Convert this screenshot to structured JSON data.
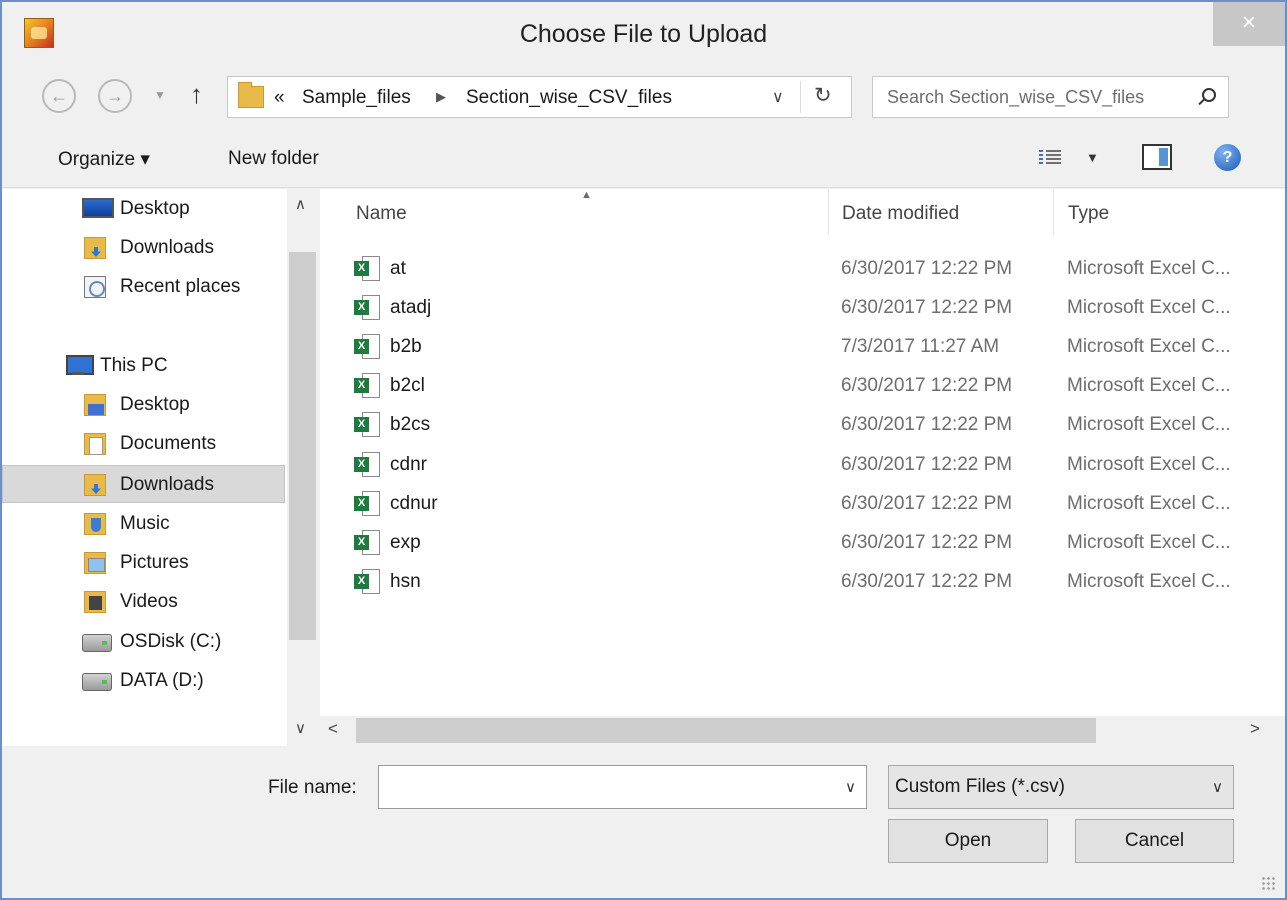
{
  "window": {
    "title": "Choose File to Upload",
    "close_label": "×",
    "app_icon": "app-logo-icon"
  },
  "navigation": {
    "back_icon": "back-arrow-icon",
    "forward_icon": "forward-arrow-icon",
    "up_icon": "up-arrow-icon",
    "breadcrumb_prefix": "«",
    "breadcrumbs": [
      "Sample_files",
      "Section_wise_CSV_files"
    ],
    "search_placeholder": "Search Section_wise_CSV_files"
  },
  "toolbar": {
    "organize_label": "Organize ▾",
    "new_folder_label": "New folder"
  },
  "sidebar": {
    "items": [
      {
        "label": "Desktop",
        "icon": "desktop-icon"
      },
      {
        "label": "Downloads",
        "icon": "downloads-folder-icon"
      },
      {
        "label": "Recent places",
        "icon": "recent-places-icon"
      },
      {
        "label": "This PC",
        "icon": "this-pc-icon"
      },
      {
        "label": "Desktop",
        "icon": "desktop-folder-icon"
      },
      {
        "label": "Documents",
        "icon": "documents-folder-icon"
      },
      {
        "label": "Downloads",
        "icon": "downloads-folder-icon",
        "selected": true
      },
      {
        "label": "Music",
        "icon": "music-folder-icon"
      },
      {
        "label": "Pictures",
        "icon": "pictures-folder-icon"
      },
      {
        "label": "Videos",
        "icon": "videos-folder-icon"
      },
      {
        "label": "OSDisk (C:)",
        "icon": "drive-icon"
      },
      {
        "label": "DATA (D:)",
        "icon": "drive-icon"
      }
    ]
  },
  "files": {
    "columns": [
      "Name",
      "Date modified",
      "Type"
    ],
    "sort_column": "Name",
    "rows": [
      {
        "name": "at",
        "date": "6/30/2017 12:22 PM",
        "type": "Microsoft Excel C..."
      },
      {
        "name": "atadj",
        "date": "6/30/2017 12:22 PM",
        "type": "Microsoft Excel C..."
      },
      {
        "name": "b2b",
        "date": "7/3/2017 11:27 AM",
        "type": "Microsoft Excel C..."
      },
      {
        "name": "b2cl",
        "date": "6/30/2017 12:22 PM",
        "type": "Microsoft Excel C..."
      },
      {
        "name": "b2cs",
        "date": "6/30/2017 12:22 PM",
        "type": "Microsoft Excel C..."
      },
      {
        "name": "cdnr",
        "date": "6/30/2017 12:22 PM",
        "type": "Microsoft Excel C..."
      },
      {
        "name": "cdnur",
        "date": "6/30/2017 12:22 PM",
        "type": "Microsoft Excel C..."
      },
      {
        "name": "exp",
        "date": "6/30/2017 12:22 PM",
        "type": "Microsoft Excel C..."
      },
      {
        "name": "hsn",
        "date": "6/30/2017 12:22 PM",
        "type": "Microsoft Excel C..."
      }
    ]
  },
  "footer": {
    "file_name_label": "File name:",
    "file_name_value": "",
    "filter_value": "Custom Files (*.csv)",
    "open_label": "Open",
    "cancel_label": "Cancel"
  },
  "colors": {
    "window_border": "#6b8fc9",
    "selection": "#d9d9d9",
    "excel_green": "#1f7a3f"
  }
}
